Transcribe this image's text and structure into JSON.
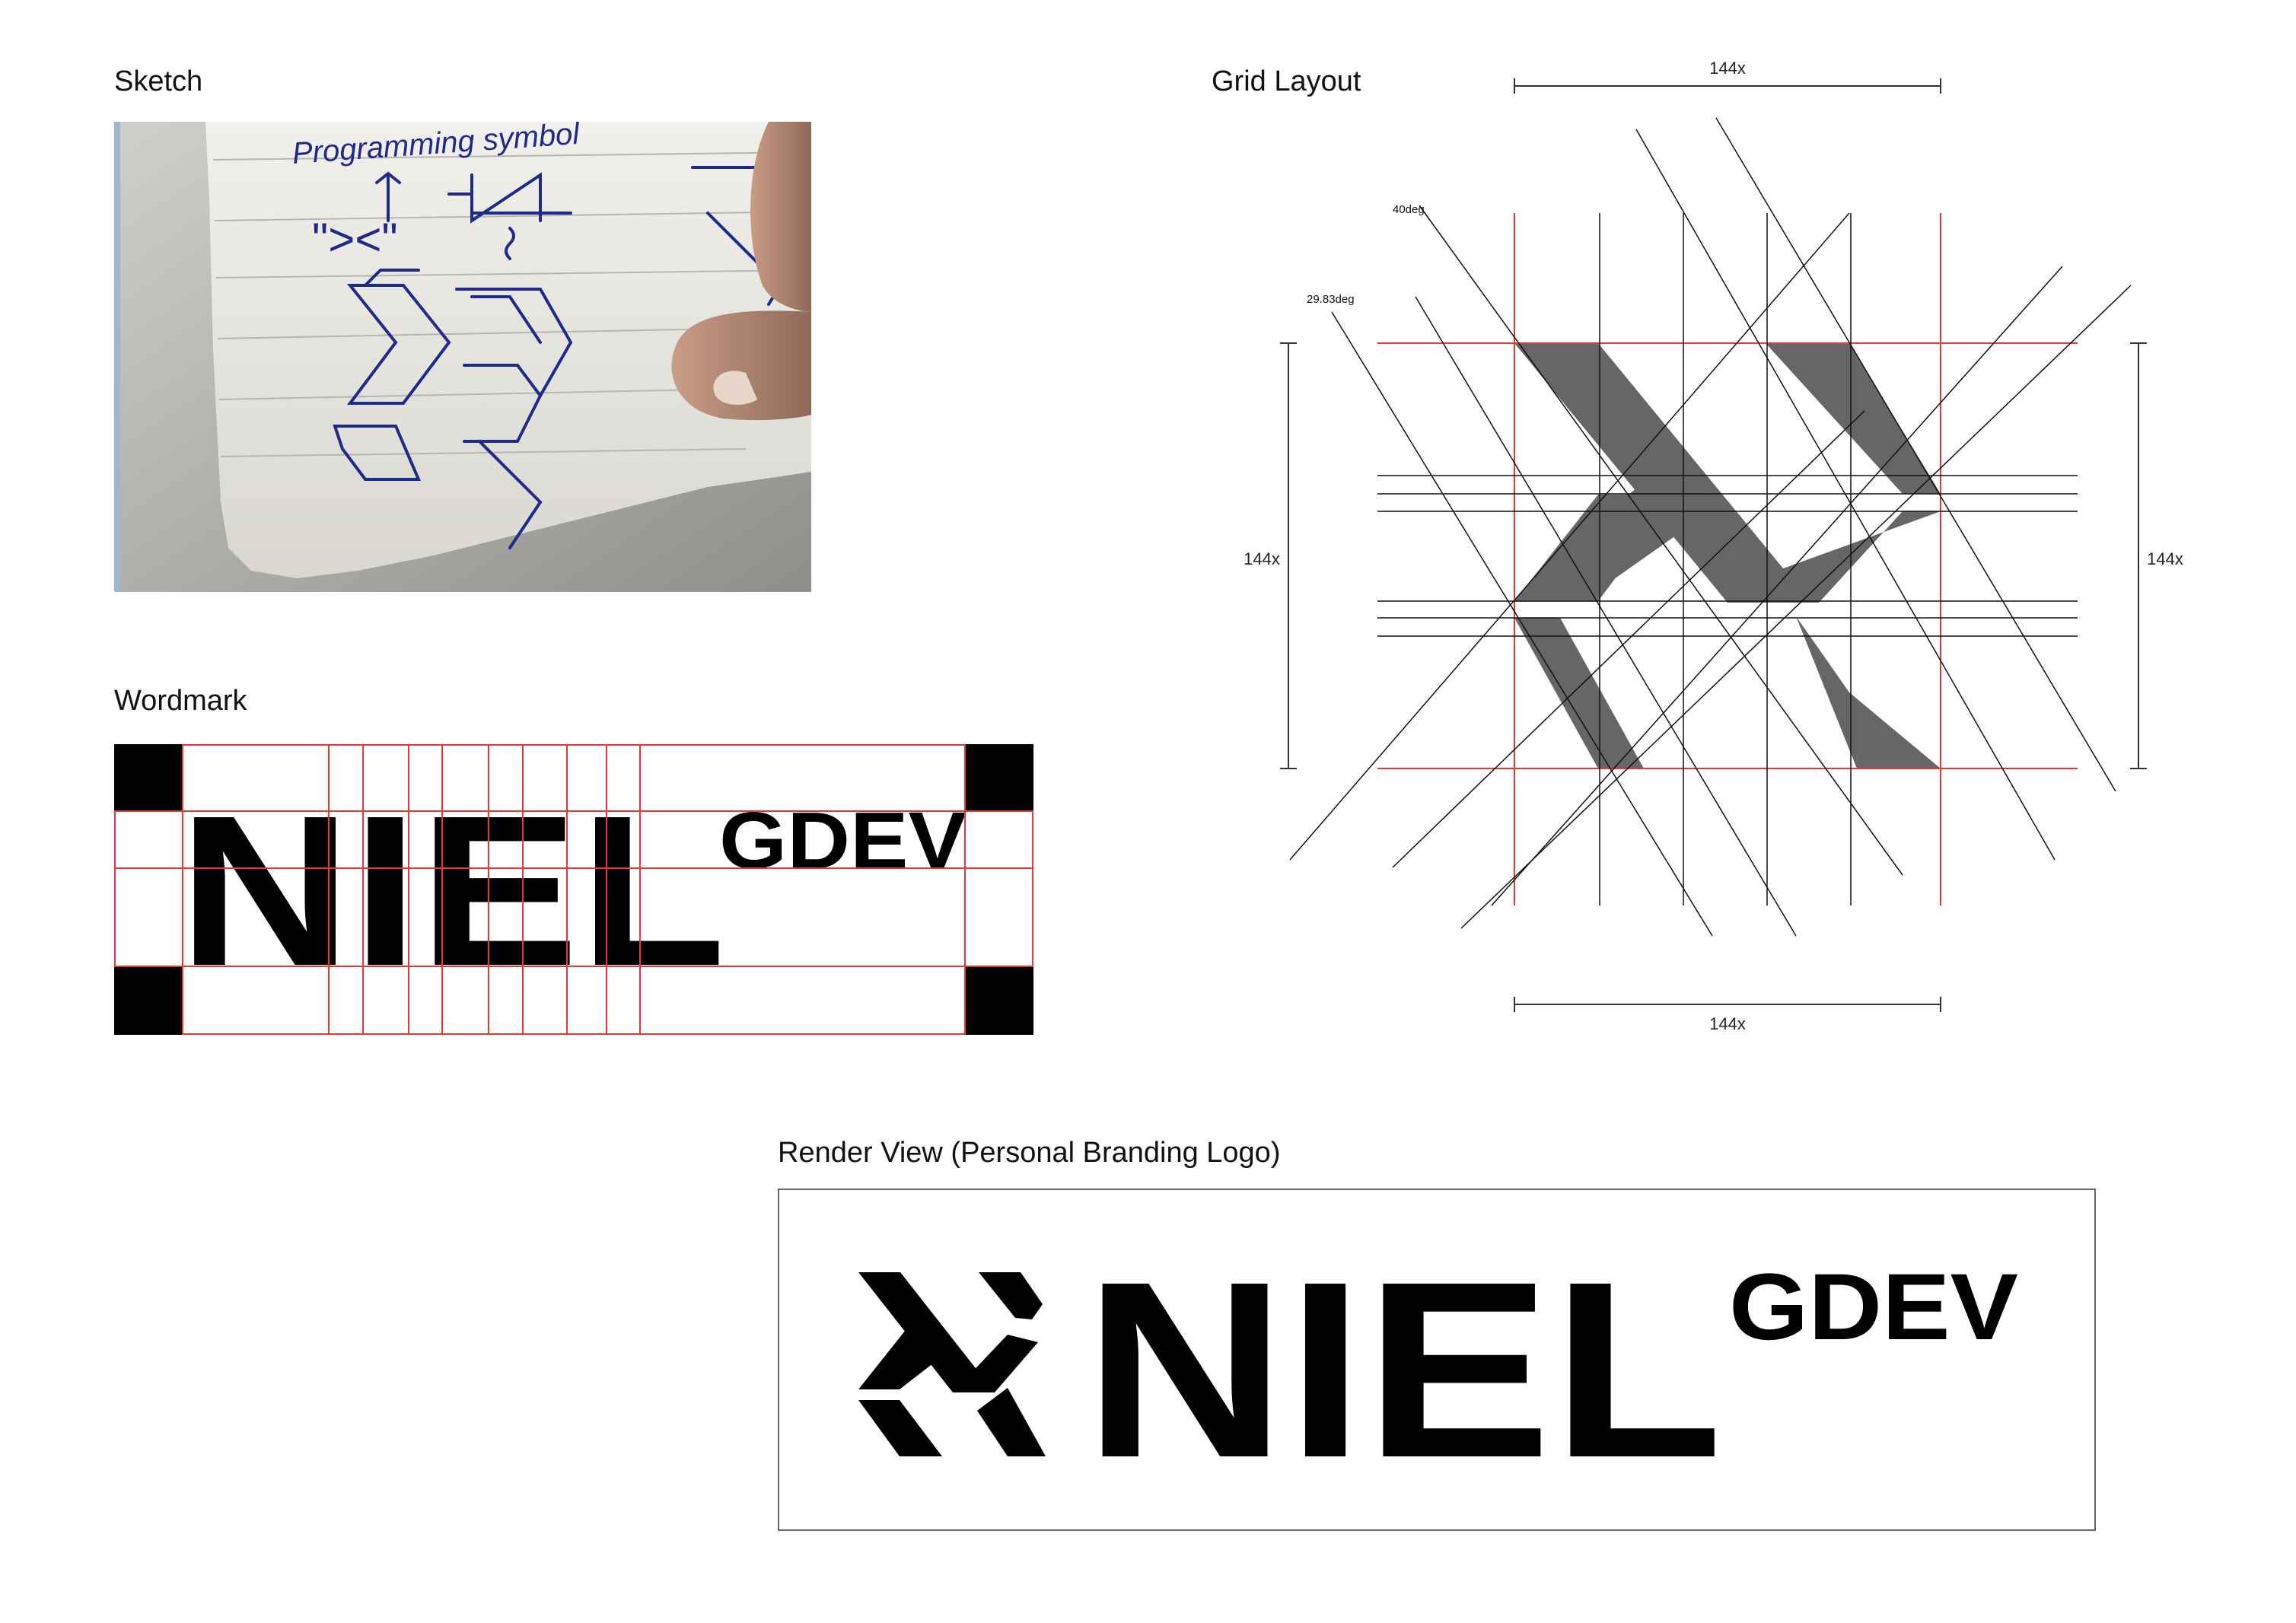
{
  "sections": {
    "sketch": "Sketch",
    "grid": "Grid Layout",
    "wordmark": "Wordmark",
    "render": "Render View (Personal Branding Logo)"
  },
  "sketch_note": {
    "line1": "Programming symbol",
    "quote": "\"><\""
  },
  "grid_annotations": {
    "dim_top": "144x",
    "dim_bottom": "144x",
    "dim_left": "144x",
    "dim_right": "144x",
    "angle_a": "40deg",
    "angle_b": "29.83deg"
  },
  "logo": {
    "name": "NIEL",
    "suffix": "GDEV"
  },
  "colors": {
    "guide_red": "#e53935",
    "symbol_gray": "#666666",
    "ink_blue": "#1f2a8a",
    "paper": "#efeeea"
  }
}
